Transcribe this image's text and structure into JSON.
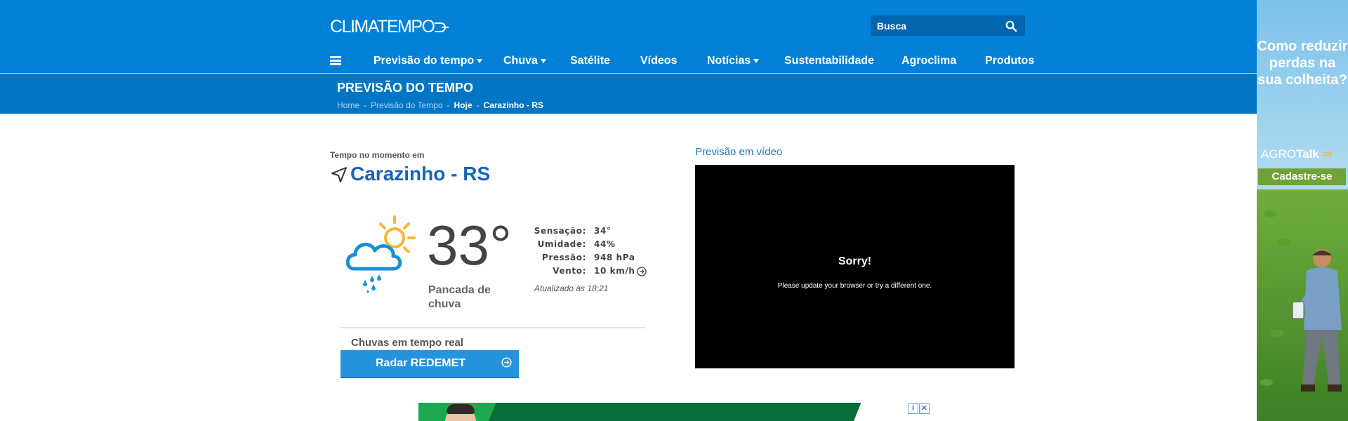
{
  "header": {
    "logo_text": "CLIMATEMPO",
    "search_placeholder": "Busca",
    "nav": [
      {
        "label": "Previsão do tempo",
        "dropdown": true
      },
      {
        "label": "Chuva",
        "dropdown": true
      },
      {
        "label": "Satélite",
        "dropdown": false
      },
      {
        "label": "Vídeos",
        "dropdown": false
      },
      {
        "label": "Notícias",
        "dropdown": true
      },
      {
        "label": "Sustentabilidade",
        "dropdown": false
      },
      {
        "label": "Agroclima",
        "dropdown": false
      },
      {
        "label": "Produtos",
        "dropdown": false
      }
    ],
    "colors": {
      "primary": "#0381d6",
      "secondary": "#0276c4"
    }
  },
  "subheader": {
    "title": "PREVISÃO DO TEMPO",
    "breadcrumb": [
      "Home",
      "Previsão do Tempo",
      "Hoje",
      "Carazinho - RS"
    ]
  },
  "current": {
    "label": "Tempo no momento em",
    "city": "Carazinho - RS",
    "temperature": "33°",
    "condition": "Pancada de chuva",
    "details": [
      {
        "key": "Sensação:",
        "value": "34°"
      },
      {
        "key": "Umidade:",
        "value": "44%"
      },
      {
        "key": "Pressão:",
        "value": "948 hPa"
      },
      {
        "key": "Vento:",
        "value": "10 km/h"
      }
    ],
    "updated": "Atualizado às 18:21",
    "icon": "sun-cloud-rain-icon"
  },
  "radar": {
    "label": "Chuvas em tempo real",
    "button": "Radar REDEMET"
  },
  "video": {
    "title": "Previsão em vídeo",
    "error_title": "Sorry!",
    "error_message": "Please update your browser or try a different one."
  },
  "side_ad": {
    "headline": "Como reduzir perdas na sua colheita?",
    "brand_regular": "AGRO",
    "brand_bold": "Talk",
    "cta": "Cadastre-se"
  },
  "ad_choices": {
    "info": "i",
    "close": "✕"
  }
}
